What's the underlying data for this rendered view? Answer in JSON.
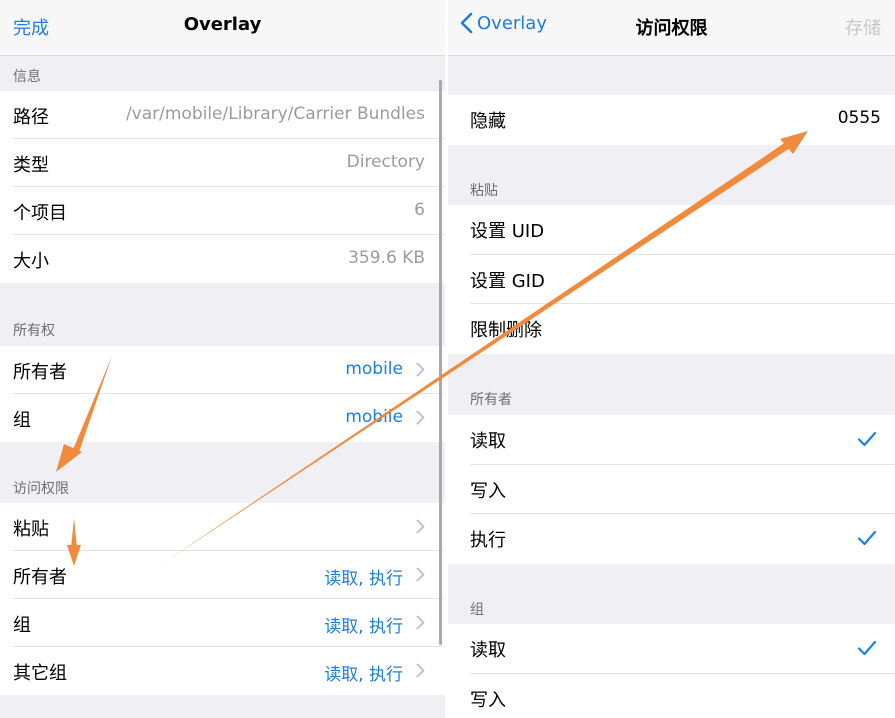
{
  "left": {
    "nav": {
      "done": "完成",
      "title": "Overlay"
    },
    "info": {
      "header": "信息",
      "rows": [
        {
          "label": "路径",
          "value": "/var/mobile/Library/Carrier Bundles"
        },
        {
          "label": "类型",
          "value": "Directory"
        },
        {
          "label": "个项目",
          "value": "6"
        },
        {
          "label": "大小",
          "value": "359.6 KB"
        }
      ]
    },
    "ownership": {
      "header": "所有权",
      "rows": [
        {
          "label": "所有者",
          "value": "mobile"
        },
        {
          "label": "组",
          "value": "mobile"
        }
      ]
    },
    "access": {
      "header": "访问权限",
      "rows": [
        {
          "label": "粘贴",
          "value": ""
        },
        {
          "label": "所有者",
          "value": "读取, 执行"
        },
        {
          "label": "组",
          "value": "读取, 执行"
        },
        {
          "label": "其它组",
          "value": "读取, 执行"
        }
      ]
    }
  },
  "right": {
    "nav": {
      "back": "Overlay",
      "title": "访问权限",
      "save": "存储"
    },
    "hidden": {
      "label": "隐藏",
      "value": "0555"
    },
    "sticky": {
      "header": "粘贴",
      "rows": [
        {
          "label": "设置 UID"
        },
        {
          "label": "设置 GID"
        },
        {
          "label": "限制删除"
        }
      ]
    },
    "owner": {
      "header": "所有者",
      "rows": [
        {
          "label": "读取",
          "checked": true
        },
        {
          "label": "写入",
          "checked": false
        },
        {
          "label": "执行",
          "checked": true
        }
      ]
    },
    "group": {
      "header": "组",
      "rows": [
        {
          "label": "读取",
          "checked": true
        },
        {
          "label": "写入",
          "checked": false
        }
      ]
    }
  },
  "colors": {
    "accent": "#1a7ee8",
    "annotation_arrow": "#f08a3c",
    "background": "#efeff4"
  }
}
